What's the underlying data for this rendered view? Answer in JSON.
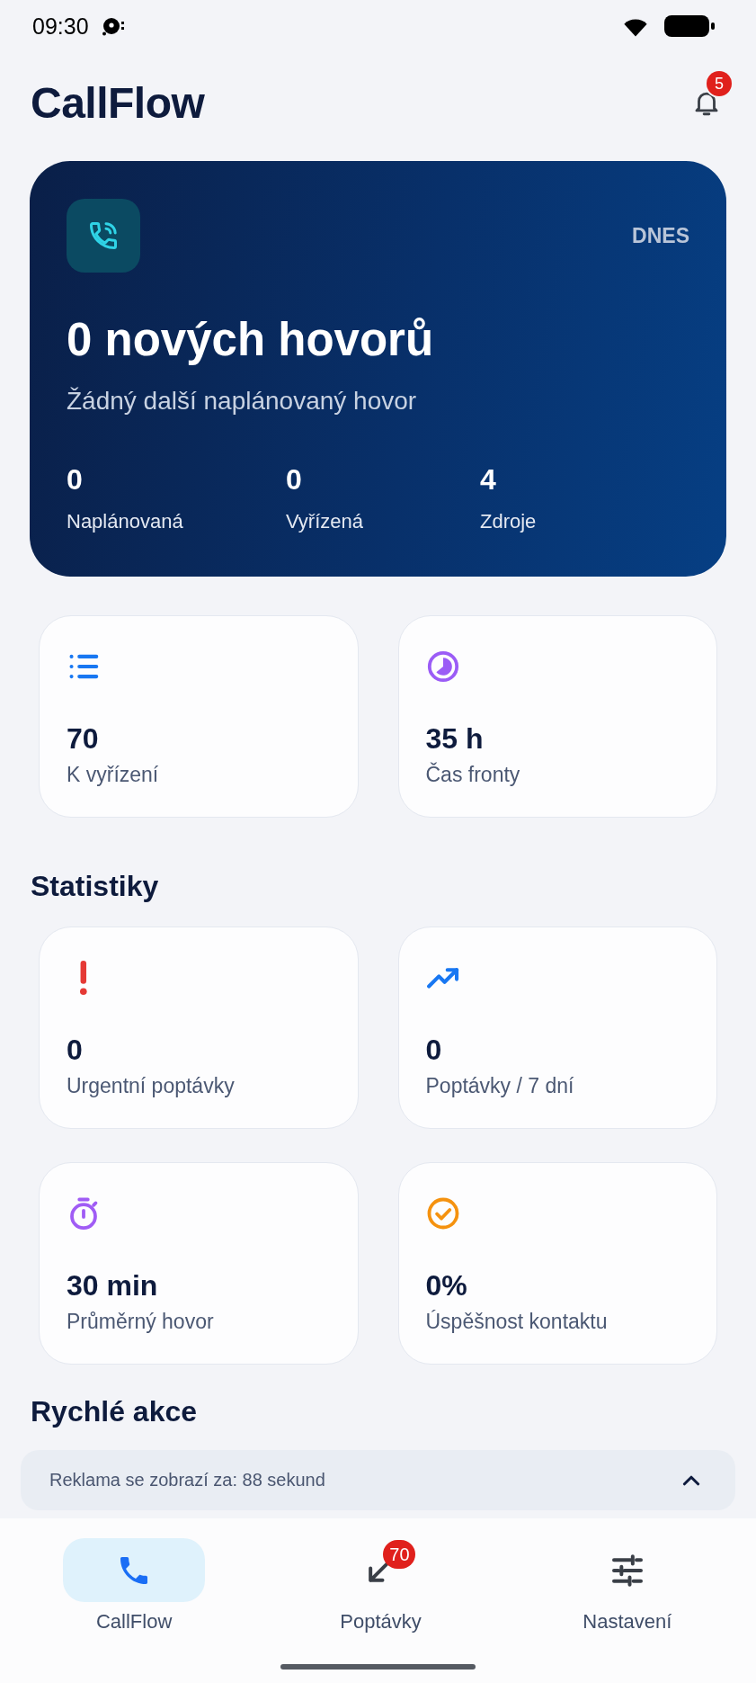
{
  "status_bar": {
    "time": "09:30"
  },
  "header": {
    "title": "CallFlow",
    "notification_badge": "5"
  },
  "hero": {
    "label": "DNES",
    "headline": "0 nových hovorů",
    "subtitle": "Žádný další naplánovaný hovor",
    "stats": [
      {
        "value": "0",
        "label": "Naplánovaná"
      },
      {
        "value": "0",
        "label": "Vyřízená"
      },
      {
        "value": "4",
        "label": "Zdroje"
      }
    ]
  },
  "overview_cards": [
    {
      "kind": "list",
      "color": "#1877f2",
      "value": "70",
      "label": "K vyřízení"
    },
    {
      "kind": "pie",
      "color": "#9b5cf6",
      "value": "35 h",
      "label": "Čas fronty"
    }
  ],
  "statistics": {
    "title": "Statistiky",
    "cards": [
      {
        "kind": "alert",
        "color": "#e53935",
        "value": "0",
        "label": "Urgentní poptávky"
      },
      {
        "kind": "trend",
        "color": "#1877f2",
        "value": "0",
        "label": "Poptávky / 7 dní"
      },
      {
        "kind": "timer",
        "color": "#a05cf5",
        "value": "30 min",
        "label": "Průměrný hovor"
      },
      {
        "kind": "check",
        "color": "#f5920f",
        "value": "0%",
        "label": "Úspěšnost kontaktu"
      }
    ]
  },
  "quick_actions": {
    "title": "Rychlé akce"
  },
  "ad_banner": {
    "text": "Reklama se zobrazí za: 88 sekund"
  },
  "bottom_nav": [
    {
      "kind": "phone",
      "label": "CallFlow",
      "selected": true
    },
    {
      "kind": "incoming",
      "label": "Poptávky",
      "selected": false,
      "badge": "70"
    },
    {
      "kind": "sliders",
      "label": "Nastavení",
      "selected": false
    }
  ]
}
